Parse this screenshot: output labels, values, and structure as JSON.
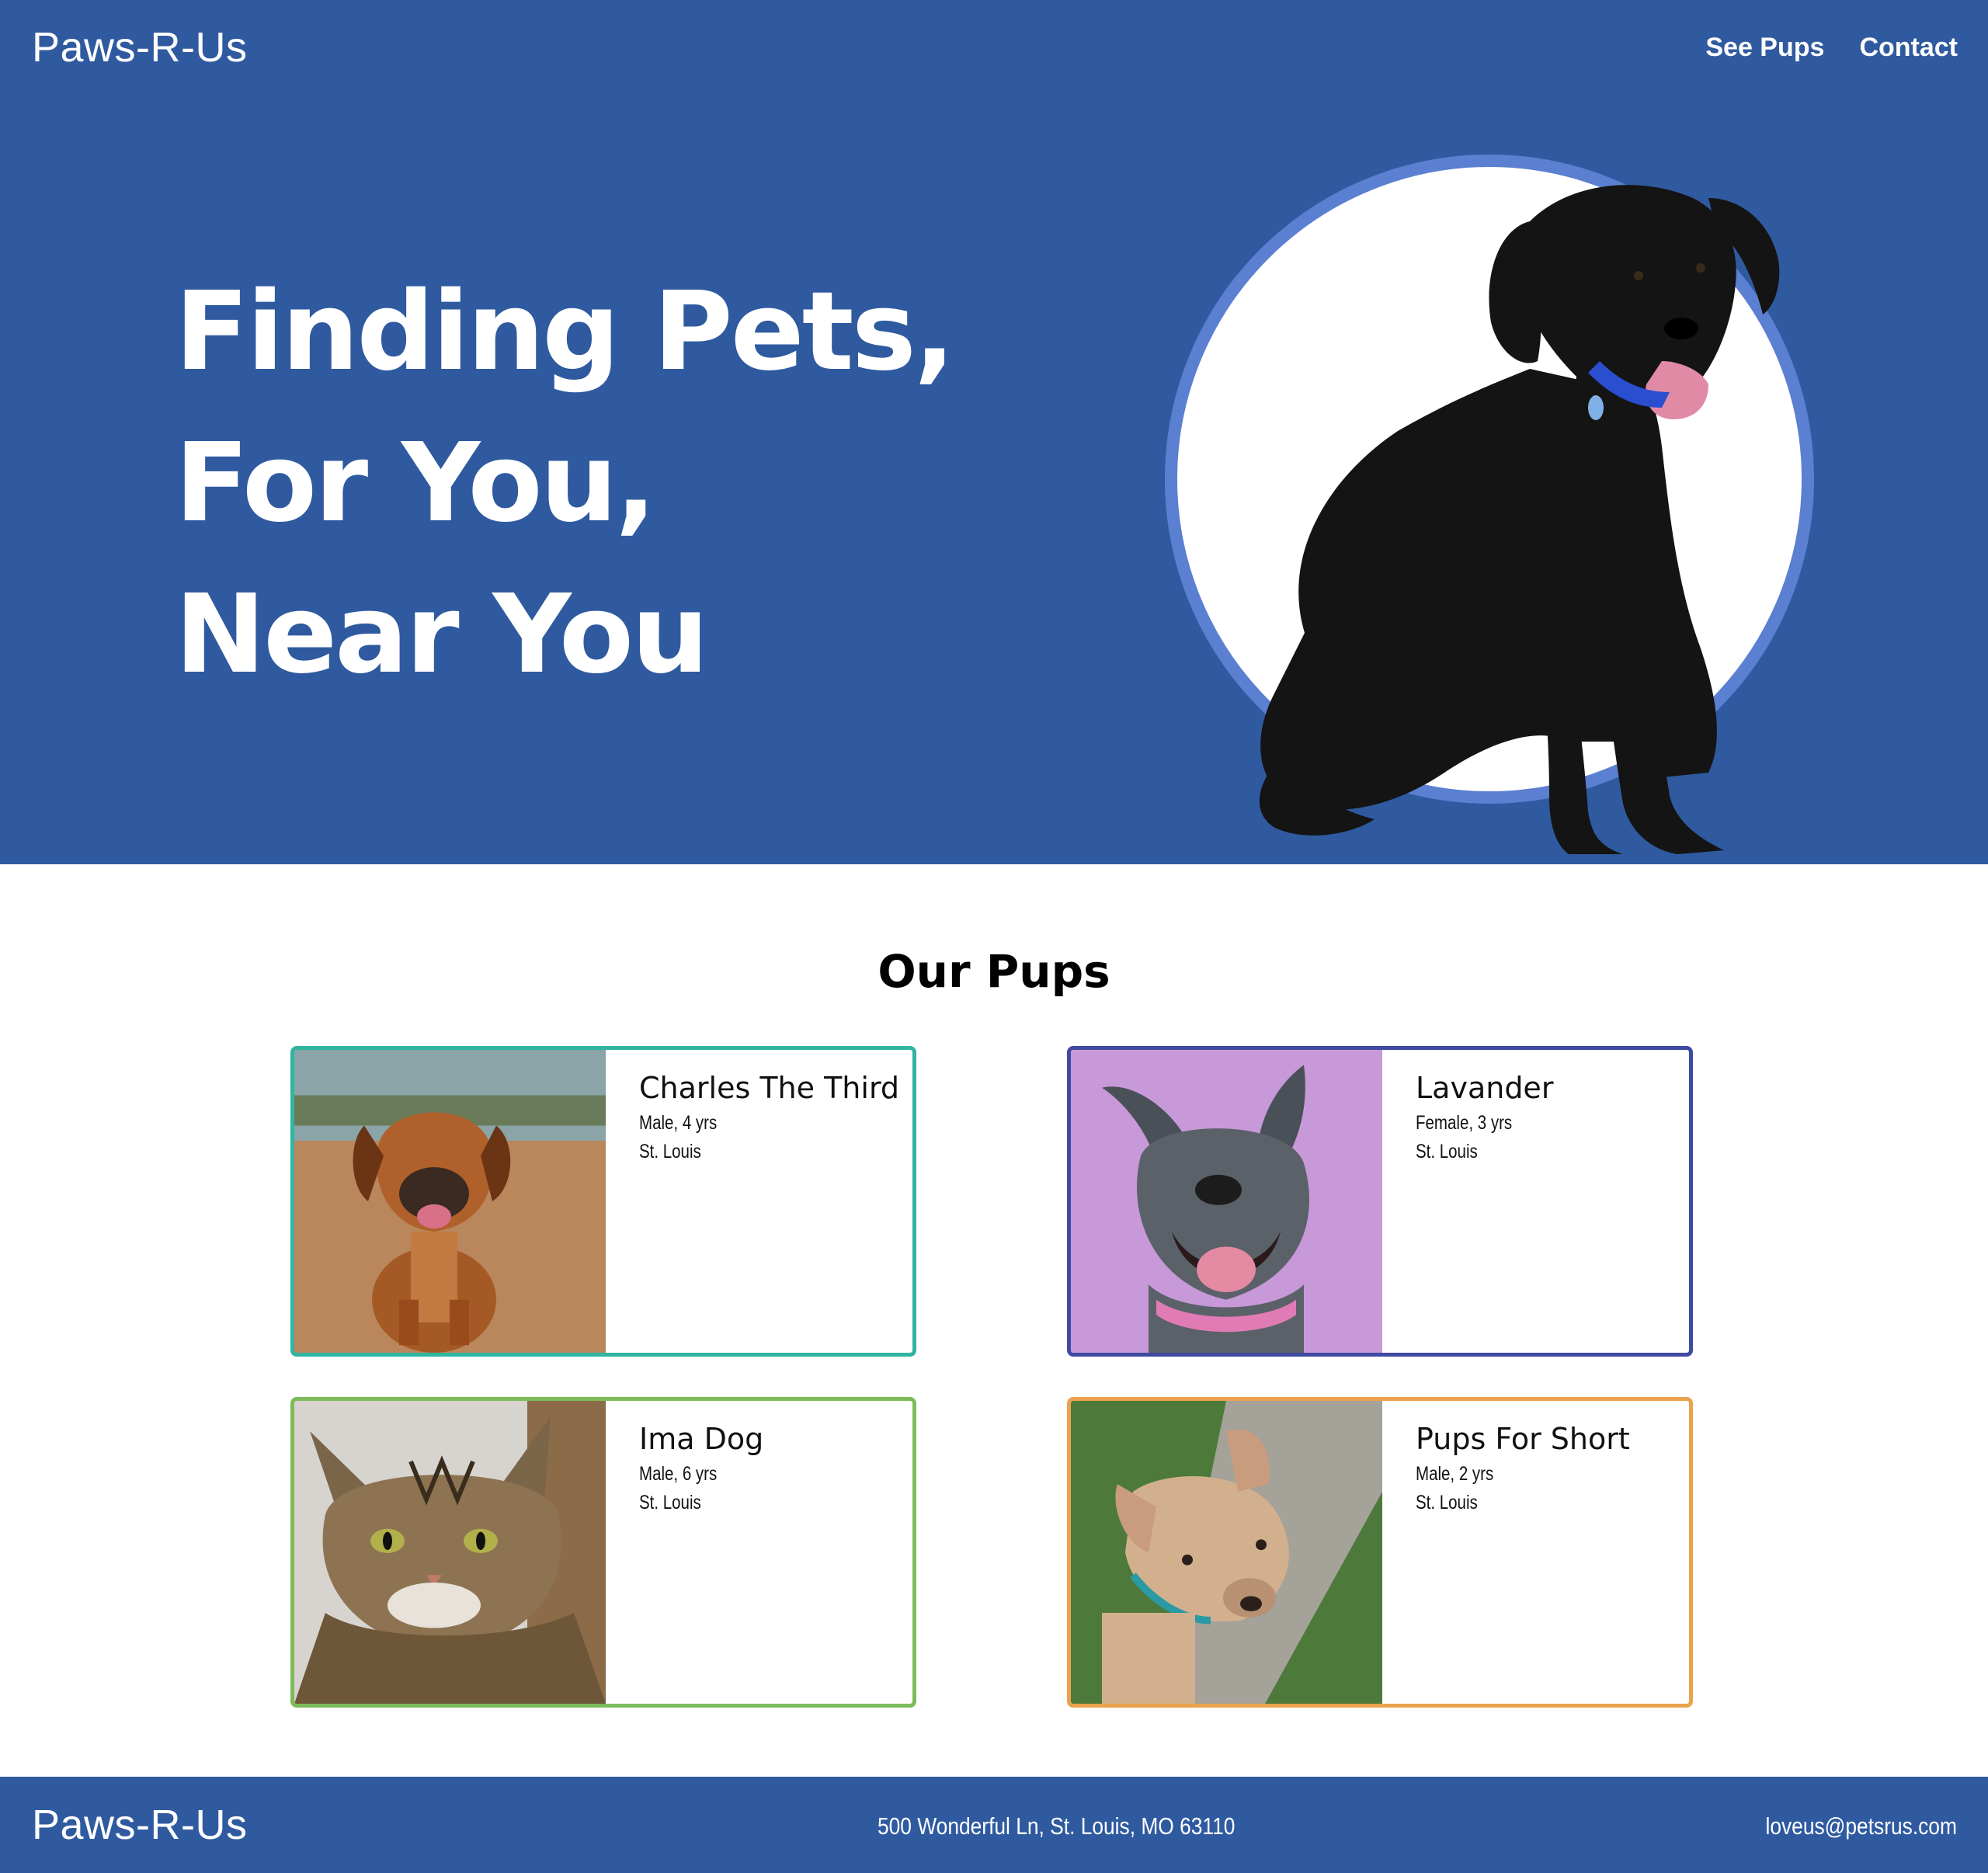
{
  "header": {
    "brand": "Paws-R-Us",
    "nav": [
      {
        "label": "See Pups"
      },
      {
        "label": "Contact"
      }
    ],
    "hero_lines": [
      "Finding Pets,",
      "For You,",
      "Near You"
    ],
    "hero_image_icon": "black-dog-in-circle"
  },
  "pups_section": {
    "title": "Our Pups",
    "cards": [
      {
        "name": "Charles The Third",
        "details": "Male, 4 yrs",
        "location": "St. Louis",
        "border_color": "#2fb5a0",
        "photo_icon": "brown-puppy-photo"
      },
      {
        "name": "Lavander",
        "details": "Female, 3 yrs",
        "location": "St. Louis",
        "border_color": "#3f4aa0",
        "photo_icon": "gray-dog-purple-background-photo"
      },
      {
        "name": "Ima Dog",
        "details": "Male, 6 yrs",
        "location": "St. Louis",
        "border_color": "#7dbb5a",
        "photo_icon": "tabby-cat-photo"
      },
      {
        "name": "Pups For Short",
        "details": "Male, 2 yrs",
        "location": "St. Louis",
        "border_color": "#eba24d",
        "photo_icon": "tan-puppy-grass-photo"
      }
    ]
  },
  "footer": {
    "brand": "Paws-R-Us",
    "address": "500 Wonderful Ln, St. Louis, MO 63110",
    "email": "loveus@petsrus.com"
  },
  "colors": {
    "primary": "#2f5aa0",
    "ring": "#5b7fd1"
  }
}
